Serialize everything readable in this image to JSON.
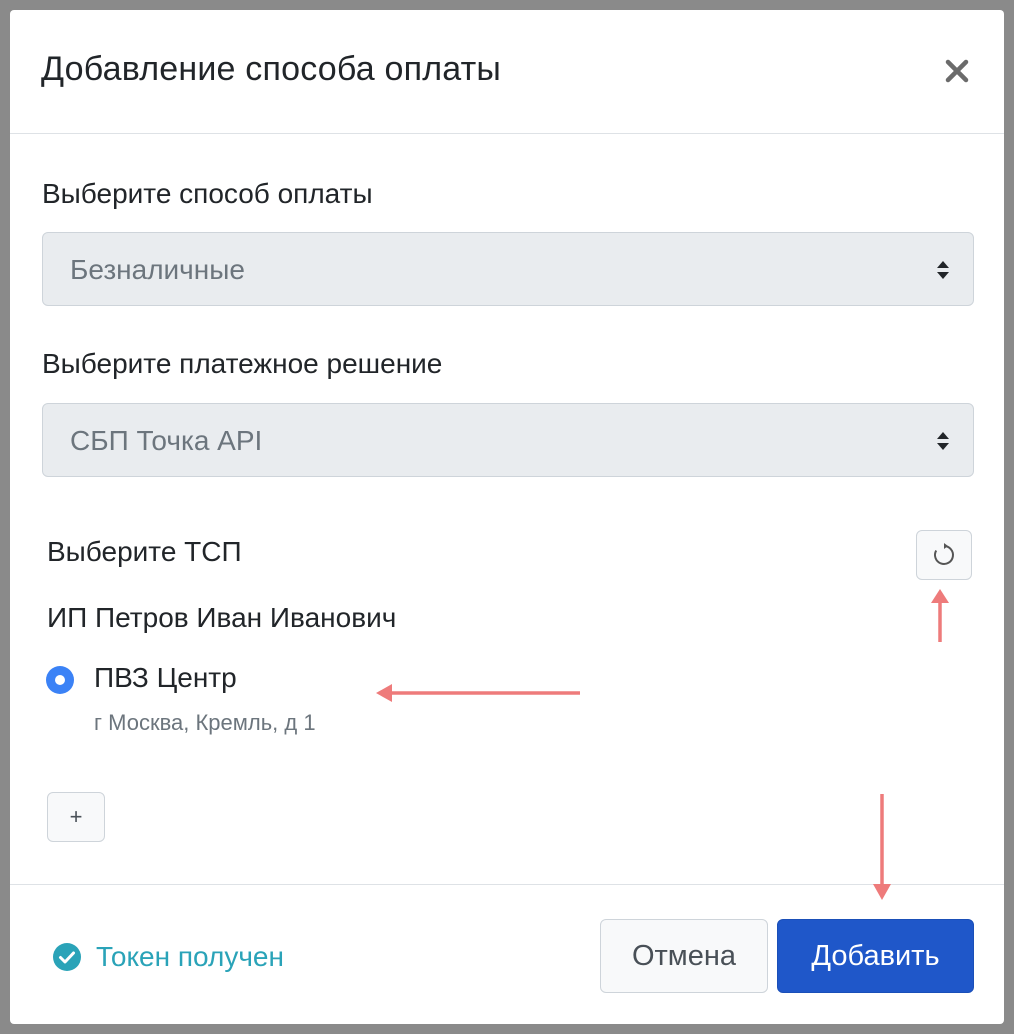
{
  "modal": {
    "title": "Добавление способа оплаты"
  },
  "payment_method": {
    "label": "Выберите способ оплаты",
    "selected": "Безналичные"
  },
  "payment_solution": {
    "label": "Выберите платежное решение",
    "selected": "СБП Точка API"
  },
  "tsp": {
    "label": "Выберите ТСП",
    "organization": "ИП Петров Иван Иванович",
    "point": {
      "name": "ПВЗ Центр",
      "address": "г Москва, Кремль, д 1",
      "selected": true
    },
    "add_label": "+"
  },
  "footer": {
    "status_text": "Токен получен",
    "cancel_label": "Отмена",
    "submit_label": "Добавить"
  },
  "colors": {
    "primary": "#1f57c9",
    "radio": "#3b82f6",
    "status": "#2aa3b8",
    "annotation_arrow": "#ee7b7b"
  },
  "icons": {
    "close": "close-icon",
    "select_arrows": "select-arrows-icon",
    "refresh": "refresh-icon",
    "status": "check-circle-icon"
  }
}
